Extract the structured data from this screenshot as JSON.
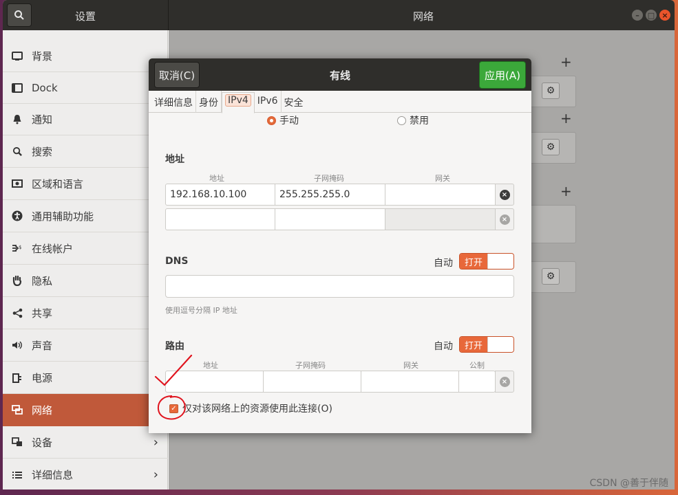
{
  "titlebar": {
    "left_title": "设置",
    "title": "网络"
  },
  "sidebar": {
    "items": [
      {
        "label": "背景"
      },
      {
        "label": "Dock"
      },
      {
        "label": "通知"
      },
      {
        "label": "搜索"
      },
      {
        "label": "区域和语言"
      },
      {
        "label": "通用辅助功能"
      },
      {
        "label": "在线帐户"
      },
      {
        "label": "隐私"
      },
      {
        "label": "共享"
      },
      {
        "label": "声音"
      },
      {
        "label": "电源"
      },
      {
        "label": "网络",
        "active": true
      },
      {
        "label": "设备"
      },
      {
        "label": "详细信息"
      }
    ]
  },
  "dialog": {
    "cancel_label": "取消(C)",
    "title": "有线",
    "apply_label": "应用(A)",
    "tabs": [
      "详细信息",
      "身份",
      "IPv4",
      "IPv6",
      "安全"
    ],
    "active_tab": "IPv4",
    "method": {
      "manual": "手动",
      "disabled": "禁用"
    },
    "address": {
      "section": "地址",
      "col_address": "地址",
      "col_netmask": "子网掩码",
      "col_gateway": "网关",
      "row1": {
        "address": "192.168.10.100",
        "netmask": "255.255.255.0",
        "gateway": ""
      }
    },
    "dns": {
      "section": "DNS",
      "auto_label": "自动",
      "toggle_label": "打开",
      "hint": "使用逗号分隔 IP 地址"
    },
    "routes": {
      "section": "路由",
      "auto_label": "自动",
      "toggle_label": "打开",
      "col_address": "地址",
      "col_netmask": "子网掩码",
      "col_gateway": "网关",
      "col_metric": "公制"
    },
    "only_local_label": "仅对该网络上的资源使用此连接(O)",
    "only_local_checked": true
  },
  "watermark": "CSDN @善于伴随",
  "colors": {
    "accent": "#e8683a",
    "apply": "#3ba83a",
    "sidebar_active": "#c0593a",
    "annotation": "#e0141e"
  }
}
